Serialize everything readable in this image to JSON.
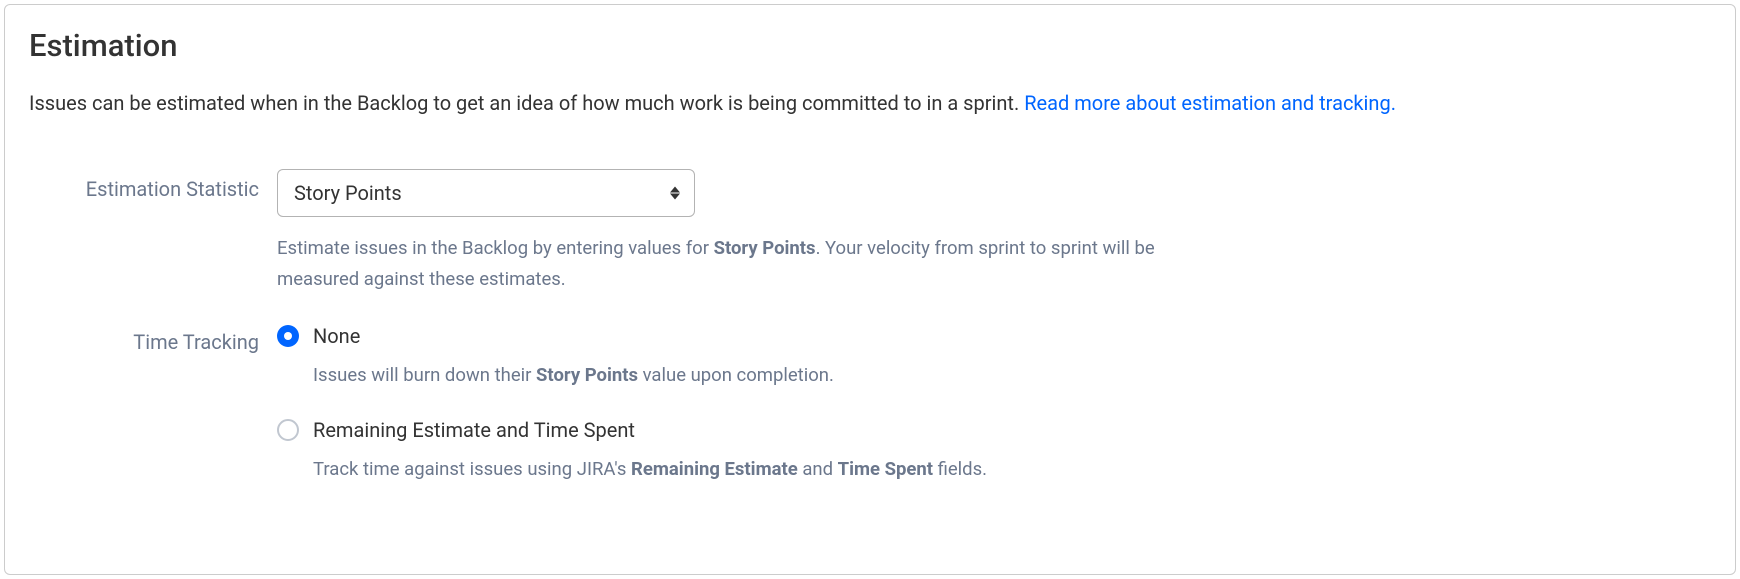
{
  "panel": {
    "title": "Estimation",
    "description_text": "Issues can be estimated when in the Backlog to get an idea of how much work is being committed to in a sprint. ",
    "description_link": "Read more about estimation and tracking."
  },
  "estimation_statistic": {
    "label": "Estimation Statistic",
    "selected": "Story Points",
    "help_pre": "Estimate issues in the Backlog by entering values for ",
    "help_bold": "Story Points",
    "help_post": ". Your velocity from sprint to sprint will be measured against these estimates."
  },
  "time_tracking": {
    "label": "Time Tracking",
    "options": [
      {
        "label": "None",
        "selected": true,
        "desc_pre": "Issues will burn down their ",
        "desc_bold1": "Story Points",
        "desc_mid": " value upon completion.",
        "desc_bold2": "",
        "desc_post": ""
      },
      {
        "label": "Remaining Estimate and Time Spent",
        "selected": false,
        "desc_pre": "Track time against issues using JIRA's ",
        "desc_bold1": "Remaining Estimate",
        "desc_mid": " and ",
        "desc_bold2": "Time Spent",
        "desc_post": " fields."
      }
    ]
  }
}
